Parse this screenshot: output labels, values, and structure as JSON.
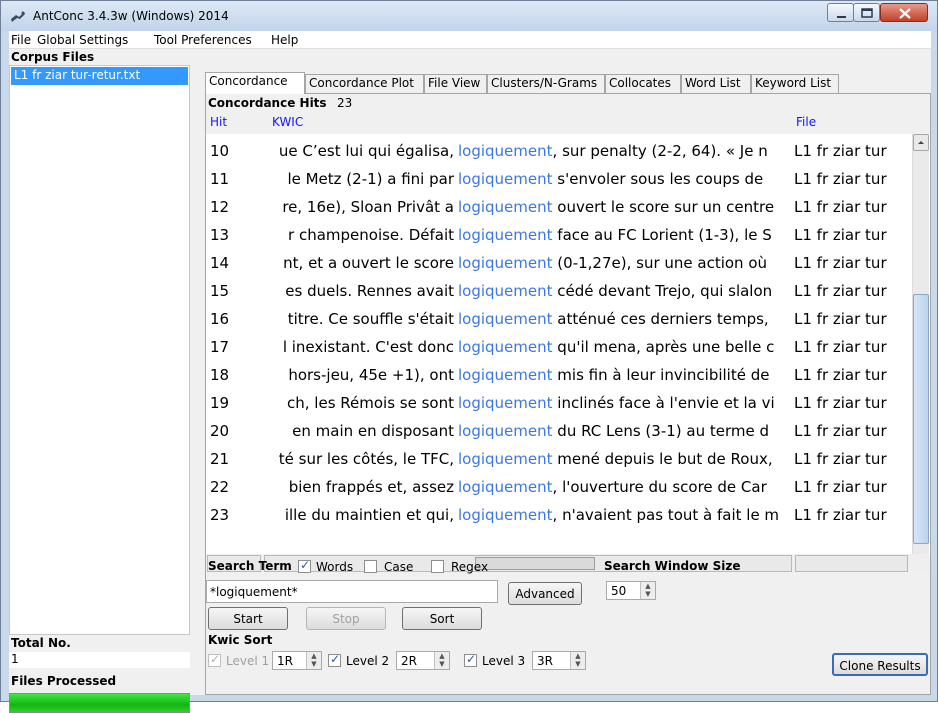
{
  "window": {
    "title": "AntConc 3.4.3w (Windows) 2014"
  },
  "menu": [
    "File",
    "Global Settings",
    "Tool Preferences",
    "Help"
  ],
  "sidebar": {
    "corpus_label": "Corpus Files",
    "files": [
      "L1 fr ziar tur-retur.txt"
    ],
    "total_label": "Total No.",
    "total_value": "1",
    "processed_label": "Files Processed",
    "progress": 1.0
  },
  "tabs": [
    "Concordance",
    "Concordance Plot",
    "File View",
    "Clusters/N-Grams",
    "Collocates",
    "Word List",
    "Keyword List"
  ],
  "active_tab": "Concordance",
  "concordance": {
    "hits_label": "Concordance Hits",
    "hits_count": "23",
    "headers": {
      "hit": "Hit",
      "kwic": "KWIC",
      "file": "File"
    },
    "rows": [
      {
        "hit": "10",
        "left": "ue C’est lui qui égalisa,",
        "kw": "logiquement",
        "right": ", sur penalty (2-2, 64).  « Je n",
        "file": "L1 fr ziar tur"
      },
      {
        "hit": "11",
        "left": "le Metz (2-1) a fini par",
        "kw": "logiquement",
        "right": " s'envoler sous les coups de ",
        "file": "L1 fr ziar tur"
      },
      {
        "hit": "12",
        "left": "re, 16e), Sloan Privât a",
        "kw": "logiquement",
        "right": " ouvert le score sur un centre",
        "file": "L1 fr ziar tur"
      },
      {
        "hit": "13",
        "left": "r champenoise. Défait",
        "kw": "logiquement",
        "right": " face au FC Lorient (1-3), le S",
        "file": "L1 fr ziar tur"
      },
      {
        "hit": "14",
        "left": "nt, et a ouvert le score",
        "kw": "logiquement",
        "right": " (0-1,27e), sur une action où ",
        "file": "L1 fr ziar tur"
      },
      {
        "hit": "15",
        "left": "es duels. Rennes avait",
        "kw": "logiquement",
        "right": " cédé devant Trejo, qui slalon",
        "file": "L1 fr ziar tur"
      },
      {
        "hit": "16",
        "left": "titre. Ce souffle s'était",
        "kw": "logiquement",
        "right": " atténué ces derniers temps, ",
        "file": "L1 fr ziar tur"
      },
      {
        "hit": "17",
        "left": "l inexistant. C'est donc",
        "kw": "logiquement",
        "right": " qu'il mena, après une belle c",
        "file": "L1 fr ziar tur"
      },
      {
        "hit": "18",
        "left": "hors-jeu, 45e +1), ont",
        "kw": "logiquement",
        "right": " mis fin à leur invincibilité de",
        "file": "L1 fr ziar tur"
      },
      {
        "hit": "19",
        "left": "ch, les Rémois se sont",
        "kw": "logiquement",
        "right": " inclinés face à l'envie et la vi",
        "file": "L1 fr ziar tur"
      },
      {
        "hit": "20",
        "left": "en main en disposant",
        "kw": "logiquement",
        "right": " du RC Lens (3-1) au terme d",
        "file": "L1 fr ziar tur"
      },
      {
        "hit": "21",
        "left": "té sur les côtés, le TFC,",
        "kw": "logiquement",
        "right": " mené depuis le but de Roux,",
        "file": "L1 fr ziar tur"
      },
      {
        "hit": "22",
        "left": "bien frappés et, assez",
        "kw": "logiquement",
        "right": ", l'ouverture du score de Car",
        "file": "L1 fr ziar tur"
      },
      {
        "hit": "23",
        "left": "ille du maintien et qui,",
        "kw": "logiquement",
        "right": ", n'avaient pas tout à fait le m",
        "file": "L1 fr ziar tur"
      }
    ]
  },
  "search": {
    "term_label": "Search Term",
    "words_label": "Words",
    "words_checked": true,
    "case_label": "Case",
    "case_checked": false,
    "regex_label": "Regex",
    "regex_checked": false,
    "query": "*logiquement*",
    "advanced_label": "Advanced",
    "window_size_label": "Search Window Size",
    "window_size": "50",
    "start_label": "Start",
    "stop_label": "Stop",
    "sort_label": "Sort",
    "kwic_sort_label": "Kwic Sort",
    "level1_label": "Level 1",
    "level1_value": "1R",
    "level2_label": "Level 2",
    "level2_value": "2R",
    "level3_label": "Level 3",
    "level3_value": "3R",
    "clone_label": "Clone Results"
  }
}
